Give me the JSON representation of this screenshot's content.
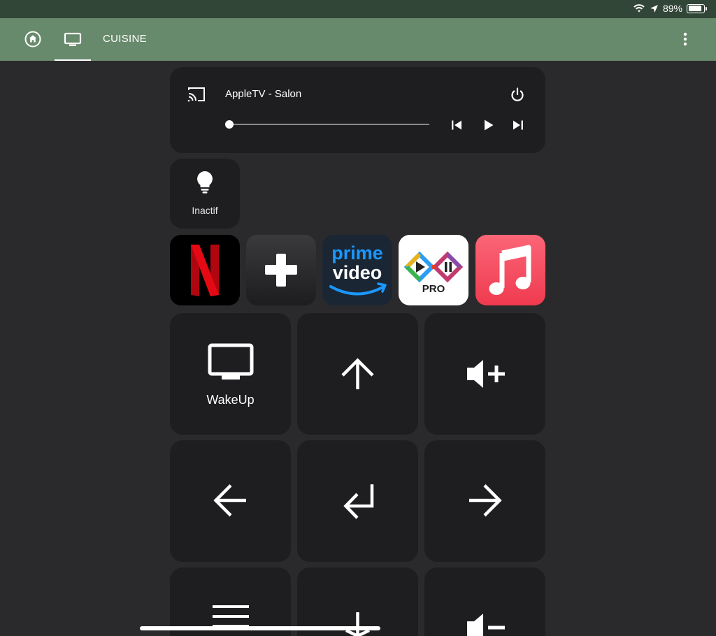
{
  "status_bar": {
    "battery": "89%",
    "battery_level": 0.89
  },
  "toolbar": {
    "title": "CUISINE"
  },
  "media_player": {
    "device_name": "AppleTV - Salon",
    "position": 0
  },
  "light": {
    "state": "Inactif"
  },
  "apps": {
    "prime_line1": "prime",
    "prime_line2": "video",
    "infuse_badge": "PRO",
    "netflix_letter": "N"
  },
  "remote": {
    "wakeup_label": "WakeUp"
  },
  "colors": {
    "status_bar": "#324637",
    "toolbar": "#688a6c",
    "background": "#2a2a2c",
    "card": "#1e1e20",
    "netflix_red": "#e50914",
    "prime_blue": "#1a98ff",
    "music_red": "#f03a4f"
  }
}
